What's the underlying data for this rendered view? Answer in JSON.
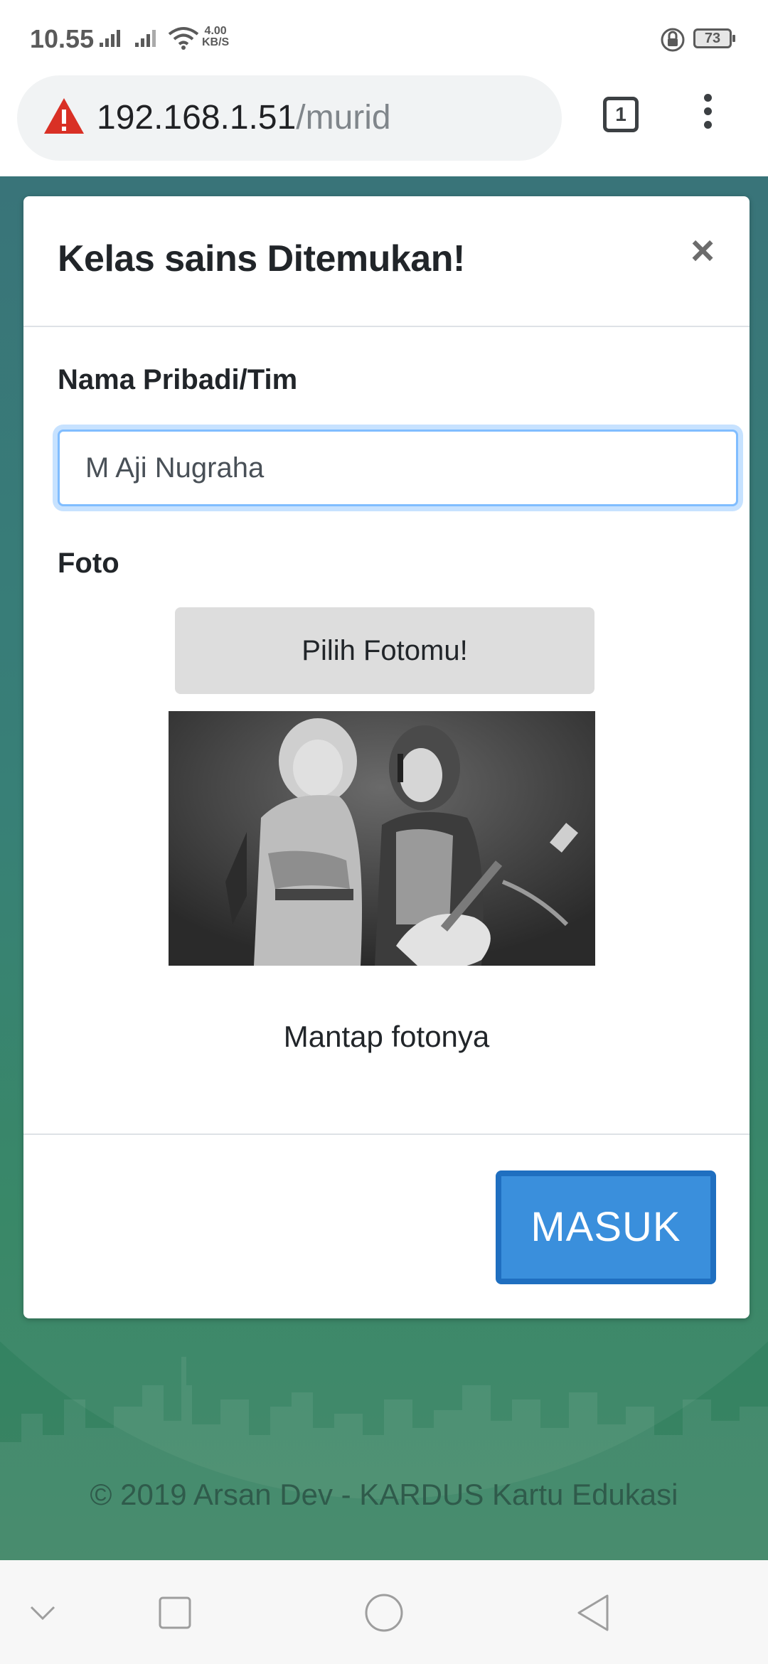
{
  "status_bar": {
    "time": "10.55",
    "net_speed_value": "4.00",
    "net_speed_unit": "KB/S",
    "battery": "73"
  },
  "browser": {
    "url_host": "192.168.1.51",
    "url_path": "/murid",
    "tab_count": "1"
  },
  "modal": {
    "title": "Kelas sains Ditemukan!",
    "close_label": "×",
    "name_label": "Nama Pribadi/Tim",
    "name_value": "M Aji Nugraha",
    "photo_label": "Foto",
    "pick_photo_label": "Pilih Fotomu!",
    "photo_caption": "Mantap fotonya",
    "submit_label": "MASUK"
  },
  "footer": {
    "text": "© 2019 Arsan Dev - KARDUS Kartu Edukasi"
  },
  "colors": {
    "primary_button": "#3a8fdc",
    "page_background": "#2e7a70",
    "warning_icon": "#d93025"
  },
  "icons": [
    "wifi-icon",
    "signal-icon",
    "lock-rotation-icon",
    "battery-icon",
    "warning-icon",
    "tabs-icon",
    "menu-icon",
    "close-icon",
    "nav-back-icon",
    "nav-home-icon",
    "nav-recents-icon",
    "nav-collapse-icon"
  ]
}
